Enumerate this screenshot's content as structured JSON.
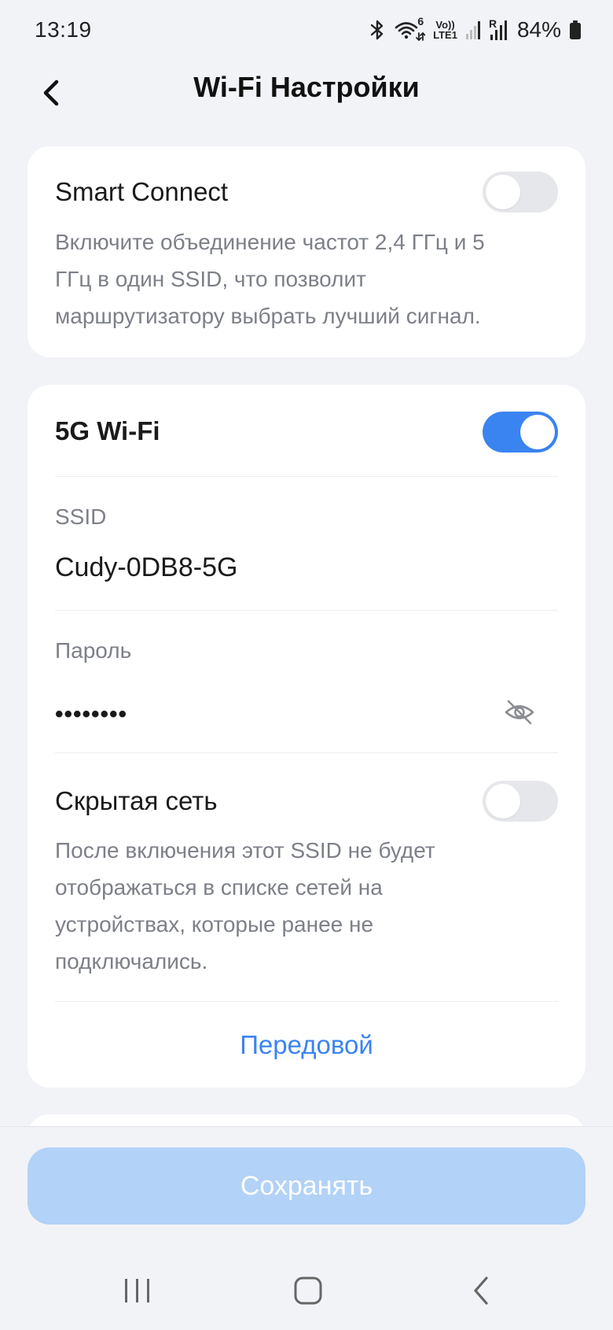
{
  "status_bar": {
    "time": "13:19",
    "battery_percent": "84%",
    "icons": [
      "bluetooth-icon",
      "wifi-6-icon",
      "volte-icon",
      "signal-icon",
      "signal-r-icon",
      "battery-icon"
    ],
    "volte_label_top": "Vo))",
    "volte_label_bottom": "LTE1",
    "wifi_badge": "6",
    "roaming_badge": "R"
  },
  "header": {
    "title": "Wi-Fi Настройки",
    "back_icon": "chevron-left-icon"
  },
  "smart_connect": {
    "title": "Smart Connect",
    "enabled": false,
    "description": "Включите объединение частот 2,4 ГГц и 5 ГГц в один SSID, что позволит маршрутизатору выбрать лучший сигнал."
  },
  "card5g": {
    "title": "5G Wi-Fi",
    "enabled": true,
    "ssid_label": "SSID",
    "ssid_value": "Cudy-0DB8-5G",
    "password_label": "Пароль",
    "password_value": "••••••••",
    "visibility_icon": "eye-off-icon",
    "hidden_network_title": "Скрытая сеть",
    "hidden_network_enabled": false,
    "hidden_network_description": "После включения этот SSID не будет отображаться в списке сетей на устройствах, которые ранее не подключались.",
    "advanced_label": "Передовой"
  },
  "footer": {
    "save_label": "Сохранять",
    "save_color": "#b2d2f7"
  },
  "nav_bar": {
    "icons": [
      "recents-icon",
      "home-icon",
      "back-icon"
    ]
  },
  "colors": {
    "accent": "#3a84f1",
    "background": "#f2f3f7",
    "toggle_off": "#e6e7ea",
    "secondary_text": "#7d8088"
  }
}
